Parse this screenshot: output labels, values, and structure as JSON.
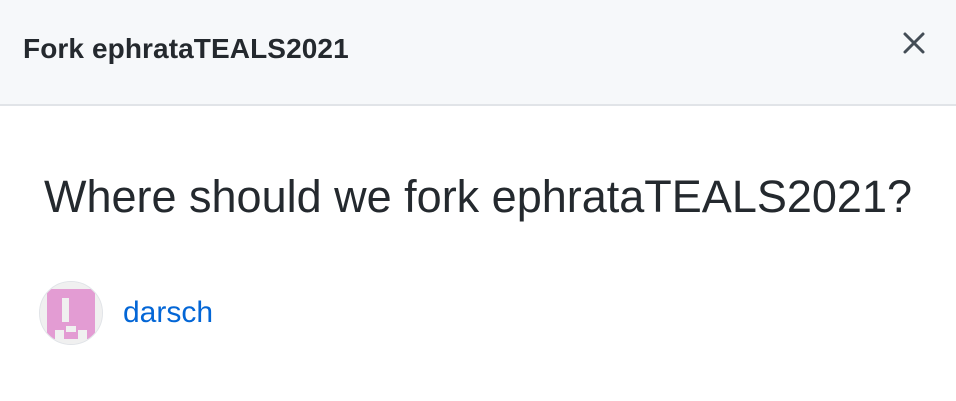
{
  "dialog": {
    "title": "Fork ephrataTEALS2021",
    "close_icon": "close-icon",
    "question": "Where should we fork ephrataTEALS2021?",
    "owners": [
      {
        "name": "darsch",
        "avatar_icon": "identicon-avatar"
      }
    ]
  },
  "colors": {
    "header_bg": "#f6f8fa",
    "link": "#0366d6",
    "text": "#24292e",
    "avatar_pink": "#e39cd3"
  }
}
